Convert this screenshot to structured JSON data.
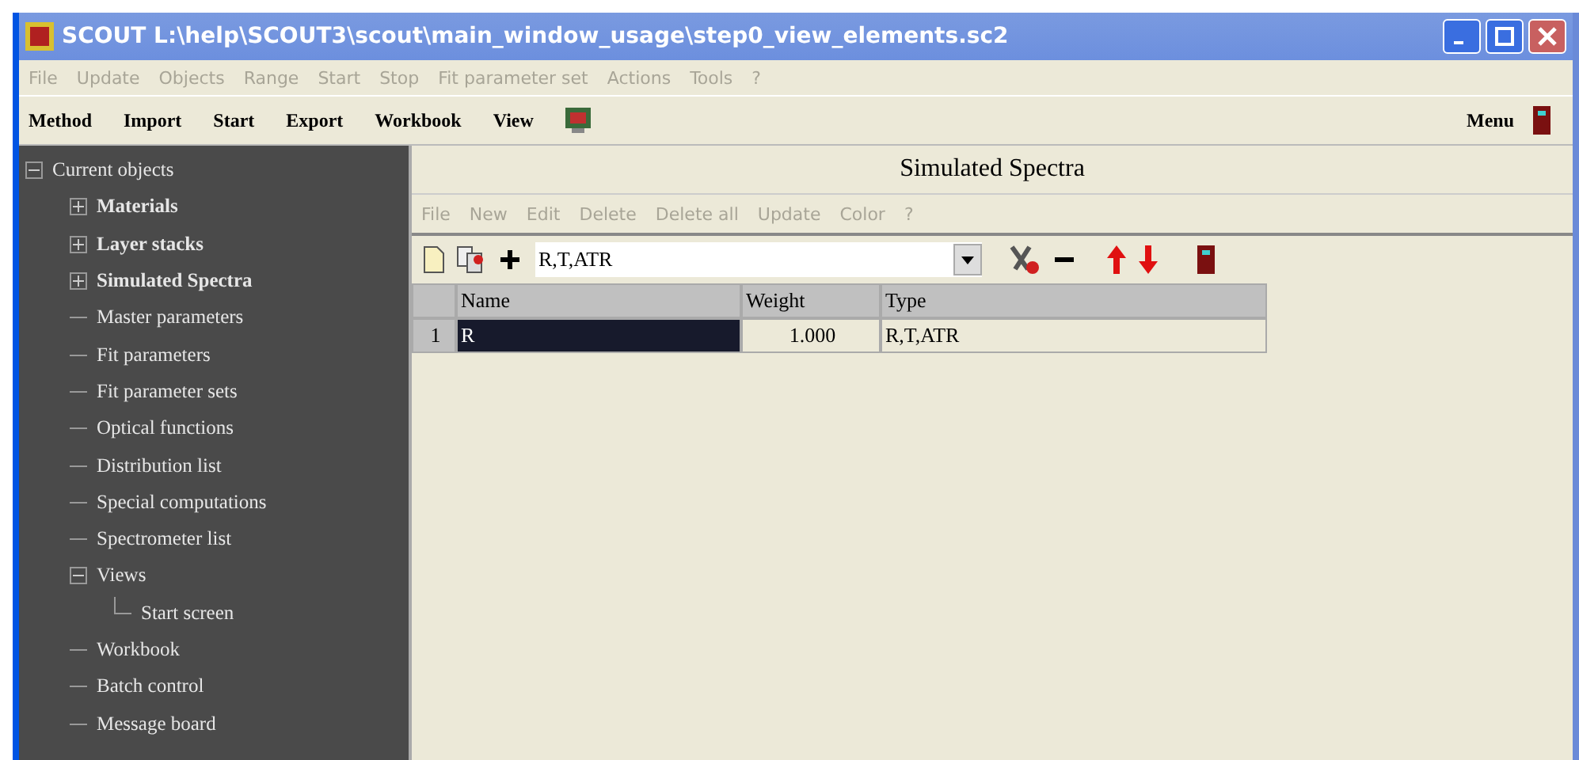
{
  "window": {
    "title": "SCOUT L:\\help\\SCOUT3\\scout\\main_window_usage\\step0_view_elements.sc2"
  },
  "menu": [
    {
      "label": "File",
      "disabled": true
    },
    {
      "label": "Update",
      "disabled": true
    },
    {
      "label": "Objects",
      "disabled": true
    },
    {
      "label": "Range",
      "disabled": true
    },
    {
      "label": "Start",
      "disabled": true
    },
    {
      "label": "Stop",
      "disabled": true
    },
    {
      "label": "Fit parameter set",
      "disabled": true
    },
    {
      "label": "Actions",
      "disabled": true
    },
    {
      "label": "Tools",
      "disabled": true
    },
    {
      "label": "?",
      "disabled": true
    }
  ],
  "toolbar": {
    "left": [
      "Method",
      "Import",
      "Start",
      "Export",
      "Workbook",
      "View"
    ],
    "right": "Menu"
  },
  "tree": [
    {
      "label": "Current objects",
      "kind": "group",
      "expanded": true,
      "bold": false,
      "children": [
        {
          "label": "Materials",
          "kind": "group",
          "expanded": false,
          "bold": true
        },
        {
          "label": "Layer stacks",
          "kind": "group",
          "expanded": false,
          "bold": true
        },
        {
          "label": "Simulated Spectra",
          "kind": "group",
          "expanded": false,
          "bold": true
        },
        {
          "label": "Master parameters",
          "kind": "leaf",
          "bold": false
        },
        {
          "label": "Fit parameters",
          "kind": "leaf",
          "bold": false
        },
        {
          "label": "Fit parameter sets",
          "kind": "leaf",
          "bold": false
        },
        {
          "label": "Optical functions",
          "kind": "leaf",
          "bold": false
        },
        {
          "label": "Distribution list",
          "kind": "leaf",
          "bold": false
        },
        {
          "label": "Special computations",
          "kind": "leaf",
          "bold": false
        },
        {
          "label": "Spectrometer list",
          "kind": "leaf",
          "bold": false
        },
        {
          "label": "Views",
          "kind": "group",
          "expanded": true,
          "bold": false,
          "children": [
            {
              "label": "Start screen",
              "kind": "leaf",
              "bold": false
            }
          ]
        },
        {
          "label": "Workbook",
          "kind": "leaf",
          "bold": false
        },
        {
          "label": "Batch control",
          "kind": "leaf",
          "bold": false
        },
        {
          "label": "Message board",
          "kind": "leaf",
          "bold": false
        }
      ]
    }
  ],
  "panel": {
    "title": "Simulated Spectra",
    "menu": [
      {
        "label": "File",
        "disabled": true
      },
      {
        "label": "New",
        "disabled": true
      },
      {
        "label": "Edit",
        "disabled": true
      },
      {
        "label": "Delete",
        "disabled": true
      },
      {
        "label": "Delete all",
        "disabled": true
      },
      {
        "label": "Update",
        "disabled": true
      },
      {
        "label": "Color",
        "disabled": true
      },
      {
        "label": "?",
        "disabled": true
      }
    ],
    "type_select": {
      "value": "R,T,ATR"
    },
    "table": {
      "columns": [
        "Name",
        "Weight",
        "Type"
      ],
      "rows": [
        {
          "index": "1",
          "cells": [
            {
              "text": "R",
              "selected": true
            },
            {
              "text": "1.000",
              "selected": false
            },
            {
              "text": "R,T,ATR",
              "selected": false
            }
          ]
        }
      ]
    }
  }
}
